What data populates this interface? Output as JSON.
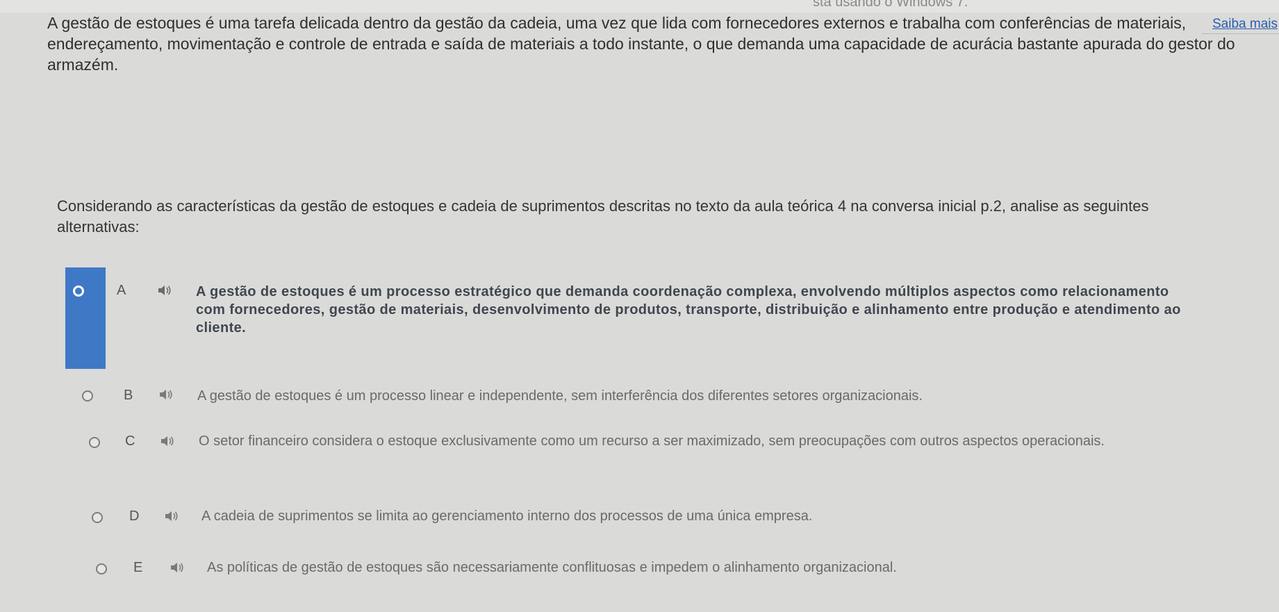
{
  "header": {
    "top_fragment": "sta usando o Windows 7.",
    "saiba_mais": "Saiba mais"
  },
  "intro_text": "A gestão de estoques é uma tarefa delicada dentro da gestão da cadeia, uma vez que lida com fornecedores externos e trabalha com conferências de materiais, endereçamento, movimentação e controle de entrada e saída de materiais a todo instante, o que demanda uma capacidade de acurácia bastante apurada do gestor do armazém.",
  "question_text": "Considerando as características da gestão de estoques e cadeia de suprimentos descritas no texto da aula teórica 4 na conversa inicial p.2, analise as seguintes alternativas:",
  "options": [
    {
      "letter": "A",
      "text": "A gestão de estoques é um processo estratégico que demanda coordenação complexa, envolvendo múltiplos aspectos como relacionamento com fornecedores, gestão de materiais, desenvolvimento de produtos, transporte, distribuição e alinhamento entre produção e atendimento ao cliente.",
      "selected": true
    },
    {
      "letter": "B",
      "text": "A gestão de estoques é um processo linear e independente, sem interferência dos diferentes setores organizacionais.",
      "selected": false
    },
    {
      "letter": "C",
      "text": "O setor financeiro considera o estoque exclusivamente como um recurso a ser maximizado, sem preocupações com outros aspectos operacionais.",
      "selected": false
    },
    {
      "letter": "D",
      "text": "A cadeia de suprimentos se limita ao gerenciamento interno dos processos de uma única empresa.",
      "selected": false
    },
    {
      "letter": "E",
      "text": "As políticas de gestão de estoques são necessariamente conflituosas e impedem o alinhamento organizacional.",
      "selected": false
    }
  ],
  "icons": {
    "audio": "speaker-icon",
    "radio": "radio-button"
  },
  "colors": {
    "selected_bar": "#3f79c6",
    "link": "#2a5db0",
    "background": "#dadad9"
  }
}
